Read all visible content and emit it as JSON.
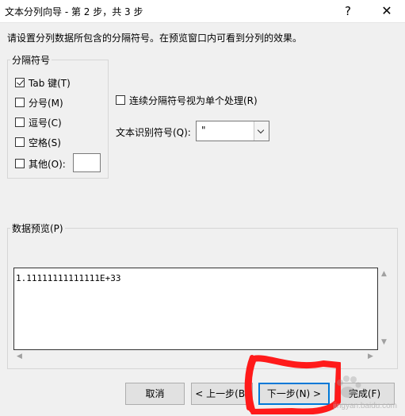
{
  "window": {
    "title": "文本分列向导 - 第 2 步，共 3 步",
    "help_glyph": "?",
    "close_glyph": "✕"
  },
  "instruction": "请设置分列数据所包含的分隔符号。在预览窗口内可看到分列的效果。",
  "delimiters": {
    "group_label": "分隔符号",
    "options": [
      {
        "label": "Tab 键(T)",
        "checked": true
      },
      {
        "label": "分号(M)",
        "checked": false
      },
      {
        "label": "逗号(C)",
        "checked": false
      },
      {
        "label": "空格(S)",
        "checked": false
      },
      {
        "label": "其他(O):",
        "checked": false
      }
    ],
    "other_value": ""
  },
  "consecutive": {
    "label": "连续分隔符号视为单个处理(R)",
    "checked": false
  },
  "text_qualifier": {
    "label": "文本识别符号(Q):",
    "value": "\""
  },
  "preview": {
    "group_label": "数据预览(P)",
    "lines": [
      "1.11111111111111E+33"
    ]
  },
  "buttons": {
    "cancel": "取消",
    "back": "< 上一步(B)",
    "next": "下一步(N) >",
    "finish": "完成(F)"
  },
  "watermark": {
    "text": "jingyan.baidu.com"
  },
  "colors": {
    "annotation": "#ff1a1a",
    "window_bg": "#f0f0f0"
  }
}
